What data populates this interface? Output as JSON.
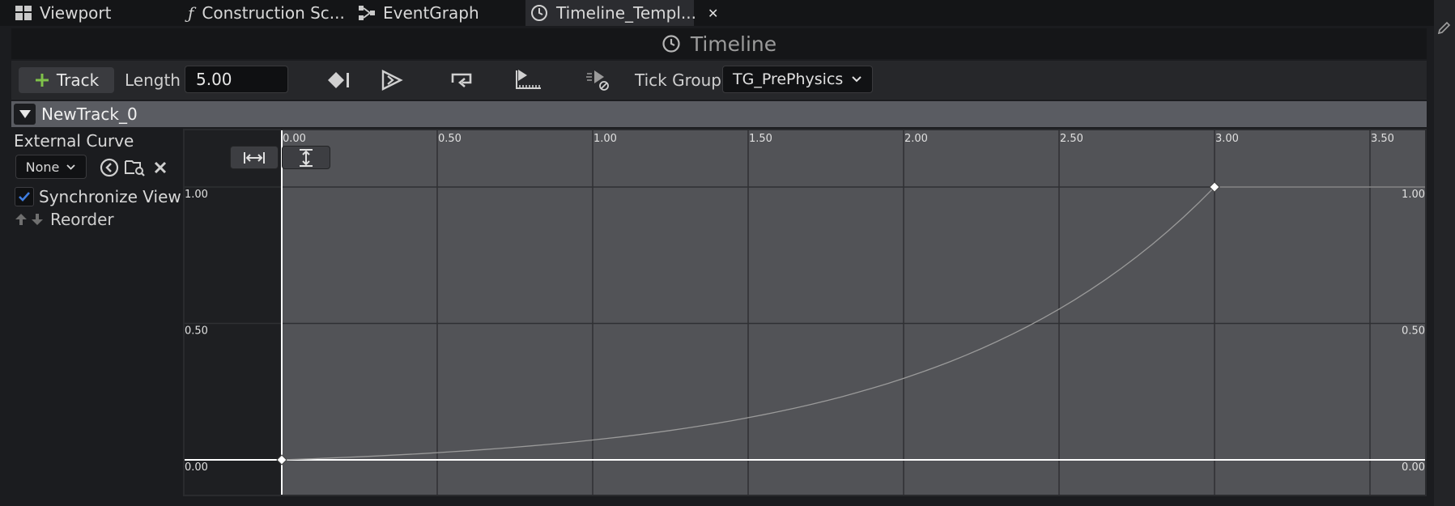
{
  "tabs": [
    {
      "label": "Viewport",
      "icon": "viewport-icon"
    },
    {
      "label": "Construction Sc...",
      "icon": "function-icon"
    },
    {
      "label": "EventGraph",
      "icon": "event-graph-icon"
    },
    {
      "label": "Timeline_Templ...",
      "icon": "clock-icon",
      "active": true
    }
  ],
  "title": "Timeline",
  "toolbar": {
    "add_track_label": "Track",
    "length_label": "Length",
    "length_value": "5.00",
    "tick_group_label": "Tick Group",
    "tick_group_value": "TG_PrePhysics"
  },
  "track": {
    "name": "NewTrack_0",
    "external_curve_label": "External Curve",
    "external_curve_value": "None",
    "synchronize_view_label": "Synchronize View",
    "synchronize_view_checked": true,
    "reorder_label": "Reorder"
  },
  "chart_data": {
    "type": "line",
    "x_ticks": [
      "0.00",
      "0.50",
      "1.00",
      "1.50",
      "2.00",
      "2.50",
      "3.00",
      "3.50"
    ],
    "y_ticks": [
      "0.00",
      "0.50",
      "1.00"
    ],
    "xlim": [
      0,
      3.5
    ],
    "ylim": [
      0,
      1
    ],
    "grid": true,
    "keys": [
      {
        "x": 0.0,
        "y": 0.0
      },
      {
        "x": 3.0,
        "y": 1.0
      }
    ],
    "curve": "exponential ease-in from (0,0) to (3,1), flat after last key",
    "colors": {
      "curve": "#9a9a9a",
      "key": "#ffffff",
      "plot_bg": "#525357",
      "gutter_bg": "#1e1f22"
    }
  }
}
